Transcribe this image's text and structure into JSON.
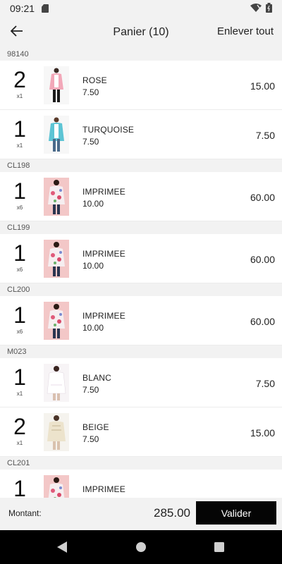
{
  "status_bar": {
    "time": "09:21",
    "icons": [
      "sd-card-icon",
      "wifi-icon",
      "battery-icon"
    ]
  },
  "header": {
    "title": "Panier (10)",
    "clear_label": "Enlever tout",
    "back_icon": "arrow-left-icon"
  },
  "groups": [
    {
      "code": "98140",
      "items": [
        {
          "qty": "2",
          "mult": "x1",
          "name": "ROSE",
          "unit_price": "7.50",
          "total": "15.00",
          "image": "pink-cardigan-photo"
        },
        {
          "qty": "1",
          "mult": "x1",
          "name": "TURQUOISE",
          "unit_price": "7.50",
          "total": "7.50",
          "image": "turquoise-cardigan-photo"
        }
      ]
    },
    {
      "code": "CL198",
      "items": [
        {
          "qty": "1",
          "mult": "x6",
          "name": "IMPRIMEE",
          "unit_price": "10.00",
          "total": "60.00",
          "image": "floral-top-photo"
        }
      ]
    },
    {
      "code": "CL199",
      "items": [
        {
          "qty": "1",
          "mult": "x6",
          "name": "IMPRIMEE",
          "unit_price": "10.00",
          "total": "60.00",
          "image": "floral-top-photo"
        }
      ]
    },
    {
      "code": "CL200",
      "items": [
        {
          "qty": "1",
          "mult": "x6",
          "name": "IMPRIMEE",
          "unit_price": "10.00",
          "total": "60.00",
          "image": "floral-top-photo"
        }
      ]
    },
    {
      "code": "M023",
      "items": [
        {
          "qty": "1",
          "mult": "x1",
          "name": "BLANC",
          "unit_price": "7.50",
          "total": "7.50",
          "image": "white-blouse-photo"
        },
        {
          "qty": "2",
          "mult": "x1",
          "name": "BEIGE",
          "unit_price": "7.50",
          "total": "15.00",
          "image": "beige-blouse-photo"
        }
      ]
    },
    {
      "code": "CL201",
      "items": [
        {
          "qty": "1",
          "mult": "",
          "name": "IMPRIMEE",
          "unit_price": "",
          "total": "",
          "image": "floral-top-photo"
        }
      ]
    }
  ],
  "footer": {
    "amount_label": "Montant:",
    "amount": "285.00",
    "validate_label": "Valider"
  },
  "nav_bar": {
    "icons": [
      "back-triangle-icon",
      "home-circle-icon",
      "recents-square-icon"
    ]
  },
  "colors": {
    "background": "#f2f2f2",
    "card": "#ffffff",
    "button": "#050505",
    "nav": "#000000"
  }
}
